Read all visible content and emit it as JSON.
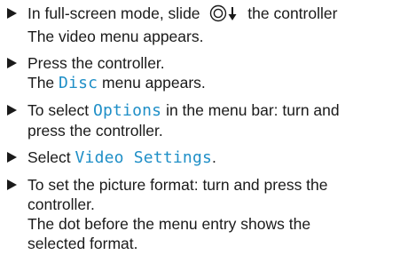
{
  "steps": [
    {
      "lines": [
        {
          "before": "In full-screen mode, slide ",
          "icon": "controller-slide-down-icon",
          "after": " the controller"
        },
        {
          "text": "The video menu appears."
        }
      ]
    },
    {
      "lines": [
        {
          "text": "Press the controller."
        },
        {
          "before": "The ",
          "term": "Disc",
          "after": " menu appears."
        }
      ]
    },
    {
      "lines": [
        {
          "before": "To select ",
          "term": "Options",
          "after": " in the menu bar: turn and"
        },
        {
          "text": "press the controller."
        }
      ]
    },
    {
      "lines": [
        {
          "before": "Select ",
          "term": "Video Settings",
          "after": "."
        }
      ]
    },
    {
      "lines": [
        {
          "text": "To set the picture format: turn and press the"
        },
        {
          "text": "controller."
        },
        {
          "text": "The dot before the menu entry shows the"
        },
        {
          "text": "selected format."
        }
      ]
    }
  ],
  "colors": {
    "menu_term": "#1f8fc7",
    "text": "#1a1a1a"
  }
}
